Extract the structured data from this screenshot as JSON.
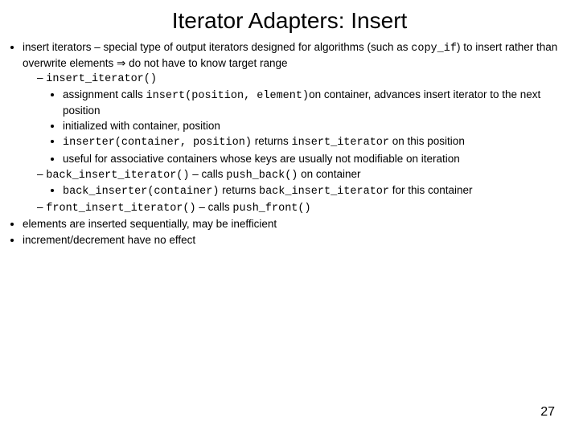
{
  "title": "Iterator Adapters: Insert",
  "b1": {
    "pre": "insert iterators – special type of output iterators designed for algorithms (such as ",
    "code": "copy_if",
    "post": ") to insert rather than overwrite elements ",
    "arrow": "⇒",
    "post2": " do not have to know target range",
    "s1": {
      "code": "insert_iterator()",
      "t1_pre": "assignment calls ",
      "t1_code": "insert(position, element)",
      "t1_post": "on container, advances insert iterator to the next position",
      "t2": "initialized with container, position",
      "t3_code1": "inserter(container, position)",
      "t3_mid": " returns ",
      "t3_code2": "insert_iterator",
      "t3_post": " on this position",
      "t4": "useful for associative containers whose keys are usually not modifiable on iteration"
    },
    "s2": {
      "code": "back_insert_iterator()",
      "mid": " – calls ",
      "code2": "push_back()",
      "post": " on container",
      "t1_code1": "back_inserter(container)",
      "t1_mid": " returns ",
      "t1_code2": "back_insert_iterator",
      "t1_post": " for this container"
    },
    "s3": {
      "code": "front_insert_iterator()",
      "mid": " – calls ",
      "code2": "push_front()"
    }
  },
  "b2": "elements are inserted sequentially, may be inefficient",
  "b3": "increment/decrement have no effect",
  "pagenum": "27"
}
